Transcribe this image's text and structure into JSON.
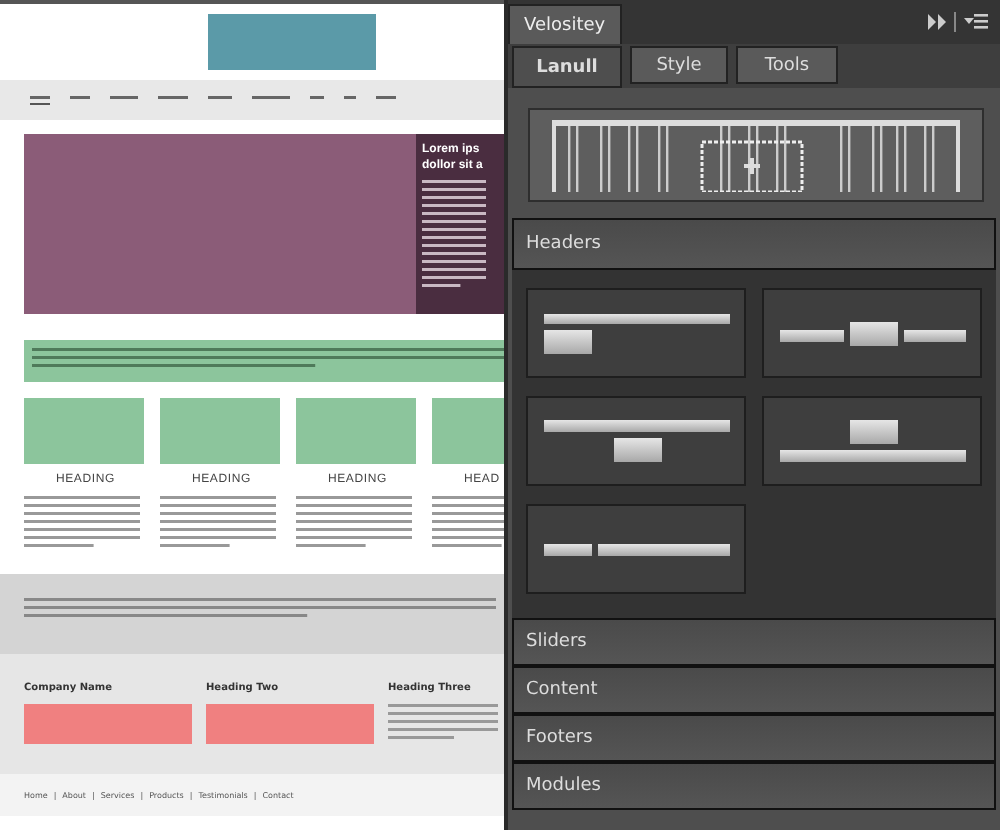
{
  "mockup": {
    "hero_title_lines": [
      "Lorem ips",
      "dollor sit a"
    ],
    "feature_headings": [
      "HEADING",
      "HEADING",
      "HEADING",
      "HEAD"
    ],
    "footer_headings": [
      "Company Name",
      "Heading Two",
      "Heading Three"
    ],
    "footer_links": [
      "Home",
      "About",
      "Services",
      "Products",
      "Testimonials",
      "Contact"
    ],
    "link_separator": "|"
  },
  "panel": {
    "title": "Velositey",
    "tabs": [
      {
        "label": "Lanull",
        "selected": true
      },
      {
        "label": "Style",
        "selected": false
      },
      {
        "label": "Tools",
        "selected": false
      }
    ],
    "sections": [
      {
        "label": "Headers",
        "expanded": true
      },
      {
        "label": "Sliders",
        "expanded": false
      },
      {
        "label": "Content",
        "expanded": false
      },
      {
        "label": "Footers",
        "expanded": false
      },
      {
        "label": "Modules",
        "expanded": false
      }
    ],
    "header_layouts": [
      {
        "kind": "bar-block-left"
      },
      {
        "kind": "bars-block-middle"
      },
      {
        "kind": "bar-block-center"
      },
      {
        "kind": "block-bar"
      },
      {
        "kind": "short-long"
      }
    ]
  }
}
